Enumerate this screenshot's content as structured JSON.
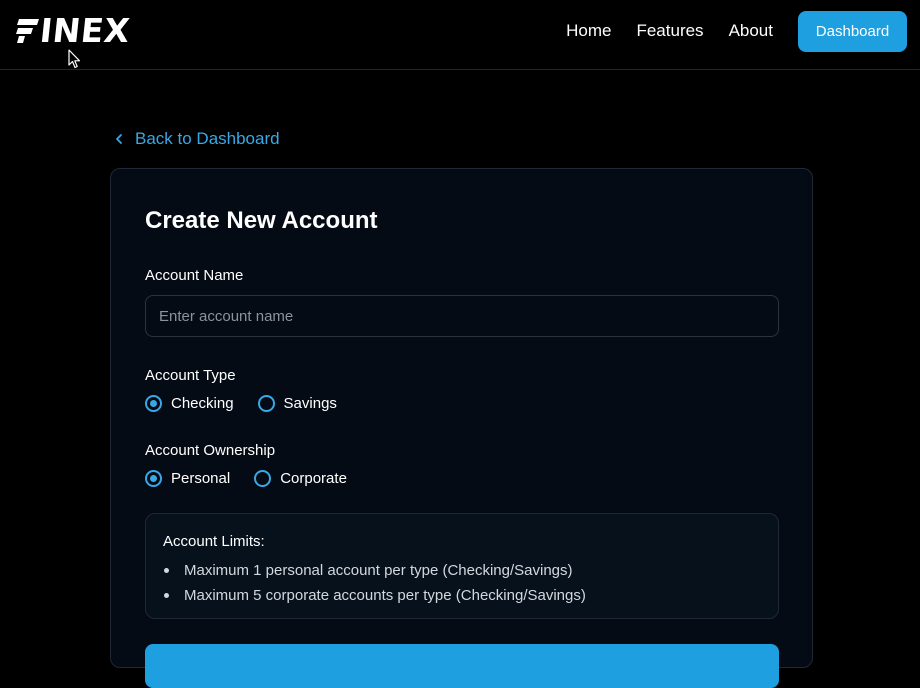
{
  "nav": {
    "logo_text": "INEX",
    "links": [
      "Home",
      "Features",
      "About"
    ],
    "dashboard_label": "Dashboard"
  },
  "back_label": "Back to Dashboard",
  "form": {
    "title": "Create New Account",
    "account_name": {
      "label": "Account Name",
      "placeholder": "Enter account name",
      "value": ""
    },
    "account_type": {
      "label": "Account Type",
      "options": [
        "Checking",
        "Savings"
      ],
      "selected": "Checking"
    },
    "ownership": {
      "label": "Account Ownership",
      "options": [
        "Personal",
        "Corporate"
      ],
      "selected": "Personal"
    },
    "limits": {
      "title": "Account Limits:",
      "items": [
        "Maximum 1 personal account per type (Checking/Savings)",
        "Maximum 5 corporate accounts per type (Checking/Savings)"
      ]
    }
  },
  "colors": {
    "accent": "#1e9fe0",
    "link": "#3aa7e6",
    "background": "#000000",
    "card": "#050b14"
  },
  "icons": {
    "logo_mark": "finex-f-mark",
    "back": "chevron-left-icon",
    "cursor": "mouse-pointer-icon"
  }
}
